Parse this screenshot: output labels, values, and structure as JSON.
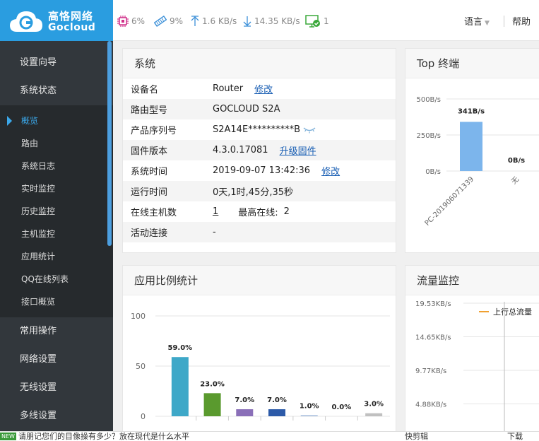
{
  "brand": {
    "name_cn": "高恪网络",
    "name_en": "Gocloud",
    "color": "#2a9de0"
  },
  "status": {
    "cpu": "6%",
    "memory": "9%",
    "upload": "1.6 KB/s",
    "download": "14.35 KB/s",
    "online_hosts": "1"
  },
  "header": {
    "language": "语言",
    "help": "帮助"
  },
  "sidebar": {
    "groups_top": [
      "设置向导",
      "系统状态"
    ],
    "sub_items": [
      "概览",
      "路由",
      "系统日志",
      "实时监控",
      "历史监控",
      "主机监控",
      "应用统计",
      "QQ在线列表",
      "接口概览"
    ],
    "active_sub": "概览",
    "groups_bottom": [
      "常用操作",
      "网络设置",
      "无线设置",
      "多线设置"
    ]
  },
  "system": {
    "title": "系统",
    "rows": [
      {
        "label": "设备名",
        "value": "Router",
        "link": "修改"
      },
      {
        "label": "路由型号",
        "value": "GOCLOUD S2A"
      },
      {
        "label": "产品序列号",
        "value": "S2A14E**********B"
      },
      {
        "label": "固件版本",
        "value": "4.3.0.17081",
        "link": "升级固件"
      },
      {
        "label": "系统时间",
        "value": "2019-09-07 13:42:36",
        "link": "修改"
      },
      {
        "label": "运行时间",
        "value": "0天,1时,45分,35秒"
      },
      {
        "label": "在线主机数",
        "value": "1",
        "extra_label": "最高在线:",
        "extra_value": "2"
      },
      {
        "label": "活动连接",
        "value": "-"
      }
    ]
  },
  "top_terminals": {
    "title": "Top 终端",
    "chart_data": {
      "type": "bar",
      "y_ticks": [
        "500B/s",
        "250B/s",
        "0B/s"
      ],
      "ylim": [
        0,
        500
      ],
      "categories": [
        "PC-201906071339",
        "无"
      ],
      "values": [
        341,
        0
      ],
      "labels": [
        "341B/s",
        "0B/s"
      ]
    }
  },
  "app_stats": {
    "title": "应用比例统计",
    "chart_data": {
      "type": "bar",
      "y_ticks": [
        "100",
        "50",
        "0"
      ],
      "ylim": [
        0,
        100
      ],
      "values": [
        59.0,
        23.0,
        7.0,
        7.0,
        1.0,
        0.0,
        3.0
      ],
      "labels": [
        "59.0%",
        "23.0%",
        "7.0%",
        "7.0%",
        "1.0%",
        "0.0%",
        "3.0%"
      ],
      "colors": [
        "#3ea8c8",
        "#5a9a2e",
        "#8a6fb8",
        "#2c5aa8",
        "#9ab4d8",
        "#e09030",
        "#c0c0c0"
      ]
    }
  },
  "traffic": {
    "title": "流量监控",
    "chart_data": {
      "type": "line",
      "y_ticks": [
        "19.53KB/s",
        "14.65KB/s",
        "9.77KB/s",
        "4.88KB/s"
      ],
      "legend": "上行总流量",
      "legend_color": "#f0a030"
    }
  },
  "bottom": {
    "badge": "NEW",
    "news": "请朋记您们的目像操有多少？放在现代是什么水平",
    "clip": "快剪辑",
    "download": "下载"
  }
}
